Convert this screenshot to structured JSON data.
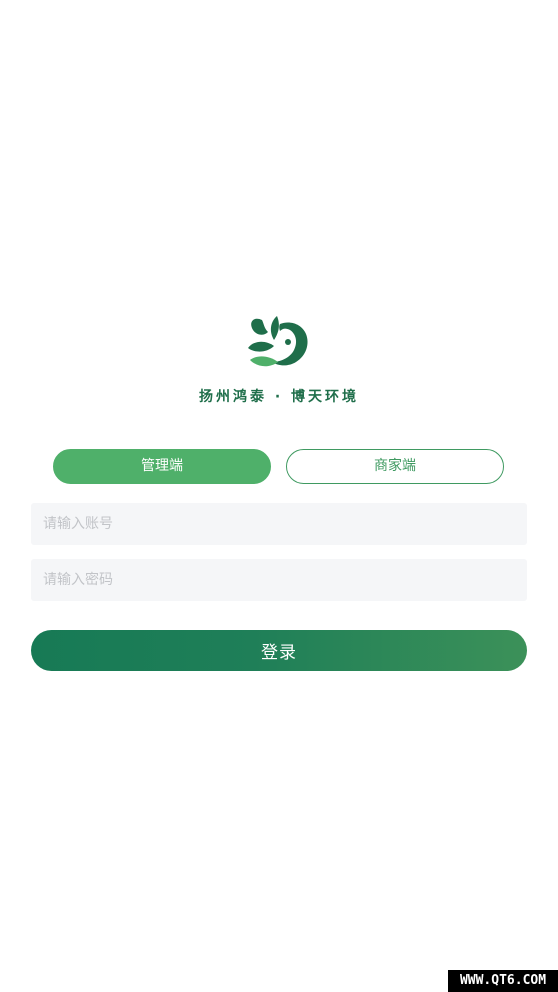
{
  "brand": {
    "logo_icon": "leaf-swirl-logo",
    "name": "扬州鸿泰 · 博天环境",
    "color": "#1f6e4a"
  },
  "role_tabs": {
    "items": [
      {
        "label": "管理端",
        "selected": true
      },
      {
        "label": "商家端",
        "selected": false
      }
    ],
    "active_color": "#4fb06a"
  },
  "form": {
    "account_placeholder": "请输入账号",
    "account_value": "",
    "password_placeholder": "请输入密码",
    "password_value": "",
    "login_label": "登录"
  },
  "watermark": {
    "text": "WWW.QT6.COM"
  }
}
